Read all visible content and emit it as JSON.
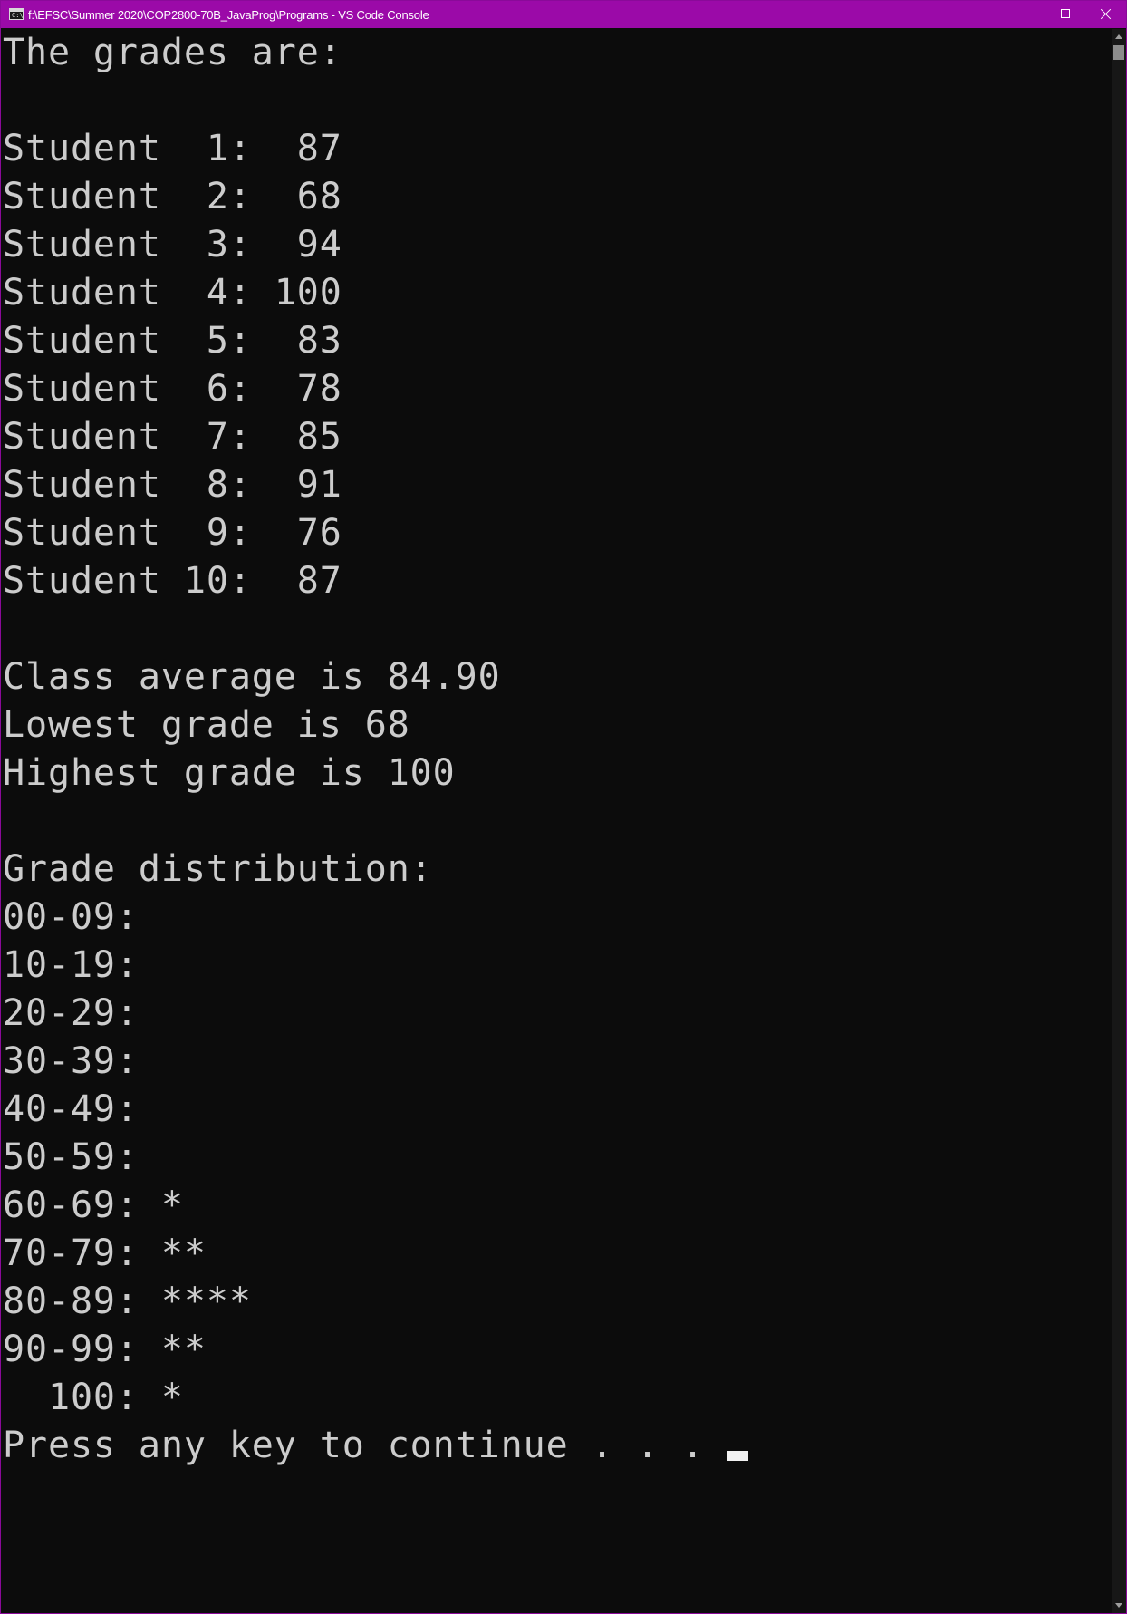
{
  "window": {
    "title": "f:\\EFSC\\Summer 2020\\COP2800-70B_JavaProg\\Programs - VS Code Console",
    "icon_label": "C:\\.",
    "icons": {
      "app": "console-icon",
      "minimize": "minimize-icon",
      "maximize": "maximize-icon",
      "close": "close-icon"
    },
    "colors": {
      "titlebar": "#9b0aa8",
      "background": "#0c0c0c",
      "text": "#cccccc"
    }
  },
  "console": {
    "lines": [
      "The grades are:",
      "",
      "Student  1:  87",
      "Student  2:  68",
      "Student  3:  94",
      "Student  4: 100",
      "Student  5:  83",
      "Student  6:  78",
      "Student  7:  85",
      "Student  8:  91",
      "Student  9:  76",
      "Student 10:  87",
      "",
      "Class average is 84.90",
      "Lowest grade is 68",
      "Highest grade is 100",
      "",
      "Grade distribution:",
      "00-09: ",
      "10-19: ",
      "20-29: ",
      "30-39: ",
      "40-49: ",
      "50-59: ",
      "60-69: *",
      "70-79: **",
      "80-89: ****",
      "90-99: **",
      "  100: *",
      "Press any key to continue . . . "
    ]
  }
}
